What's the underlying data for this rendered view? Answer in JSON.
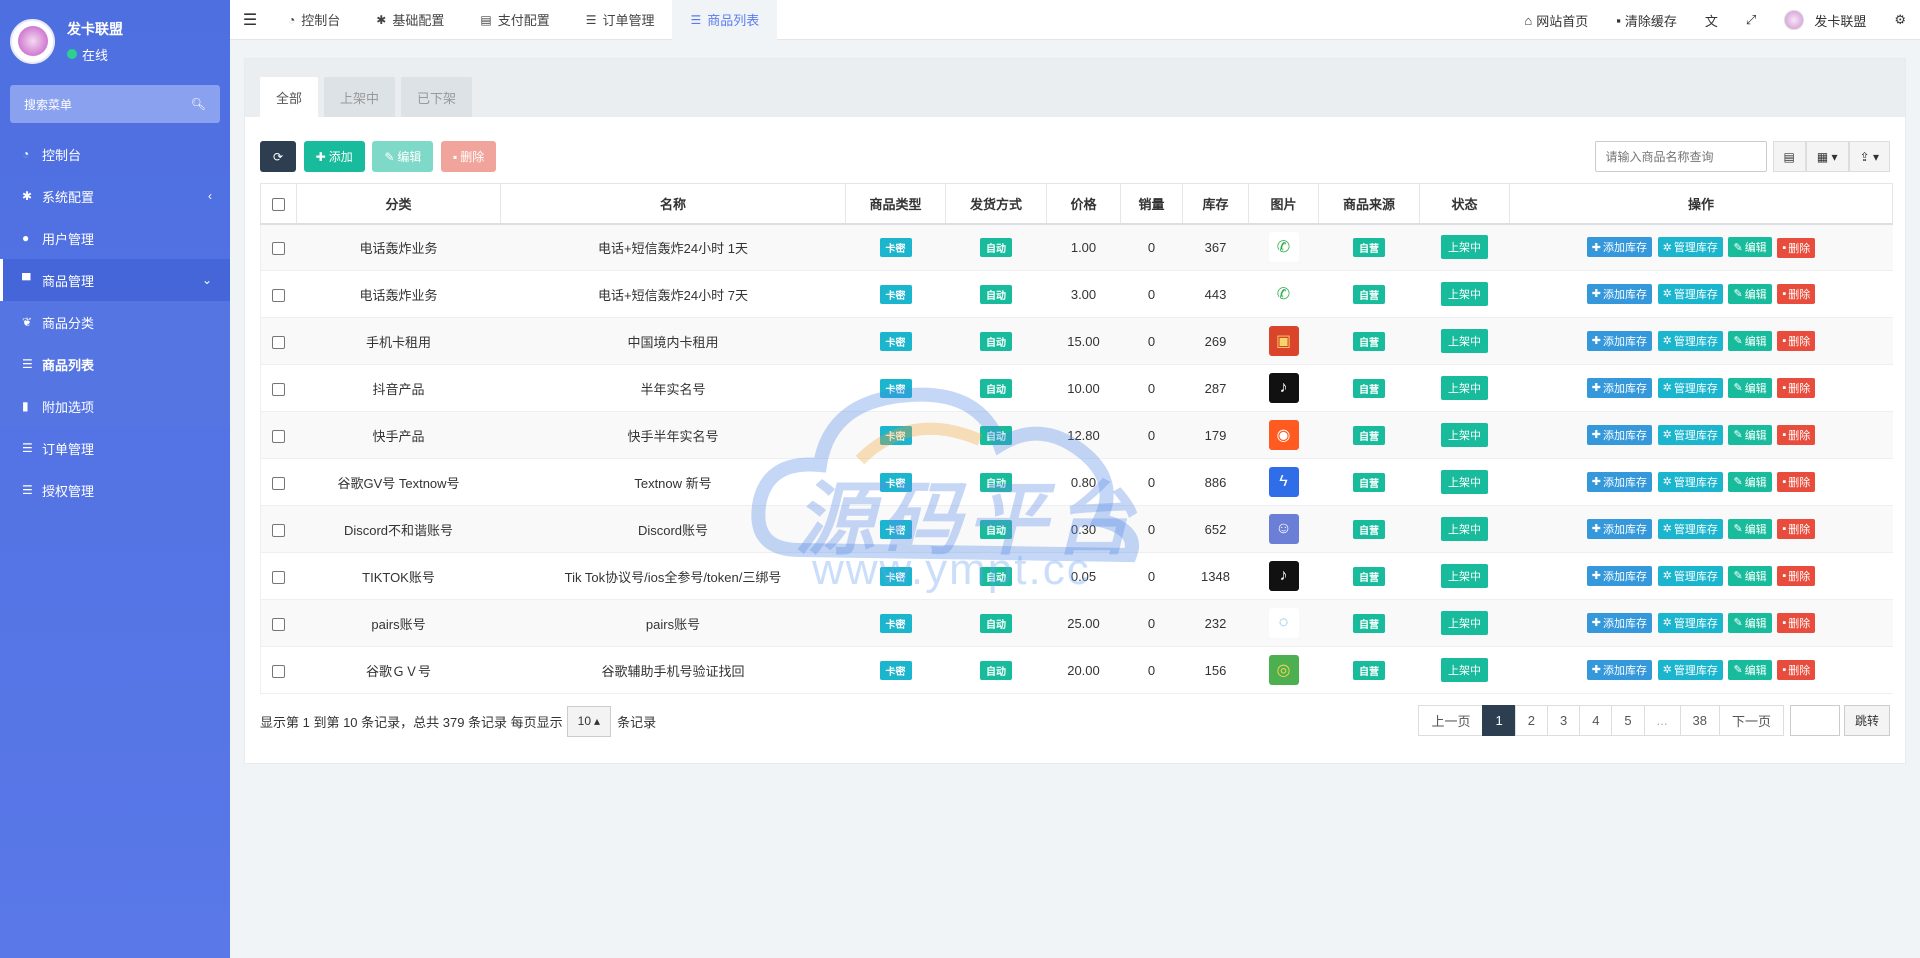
{
  "sidebar": {
    "user_name": "发卡联盟",
    "status": "在线",
    "search_placeholder": "搜索菜单",
    "items": [
      {
        "label": "控制台",
        "icon": "dashboard-icon"
      },
      {
        "label": "系统配置",
        "icon": "gear-icon"
      },
      {
        "label": "用户管理",
        "icon": "user-icon"
      },
      {
        "label": "商品管理",
        "icon": "cart-icon"
      },
      {
        "label": "商品分类",
        "icon": "leaf-icon"
      },
      {
        "label": "商品列表",
        "icon": "list-icon"
      },
      {
        "label": "附加选项",
        "icon": "bookmark-icon"
      },
      {
        "label": "订单管理",
        "icon": "list-icon"
      },
      {
        "label": "授权管理",
        "icon": "list-icon"
      }
    ]
  },
  "topbar": {
    "tabs": [
      {
        "label": "控制台"
      },
      {
        "label": "基础配置"
      },
      {
        "label": "支付配置"
      },
      {
        "label": "订单管理"
      },
      {
        "label": "商品列表"
      }
    ],
    "home_label": "网站首页",
    "clear_cache_label": "清除缓存",
    "user_label": "发卡联盟"
  },
  "filter_tabs": [
    "全部",
    "上架中",
    "已下架"
  ],
  "toolbar": {
    "add_label": "添加",
    "edit_label": "编辑",
    "delete_label": "删除",
    "search_placeholder": "请输入商品名称查询"
  },
  "table": {
    "headers": [
      "分类",
      "名称",
      "商品类型",
      "发货方式",
      "价格",
      "销量",
      "库存",
      "图片",
      "商品来源",
      "状态",
      "操作"
    ],
    "type_label": "卡密",
    "ship_label": "自动",
    "source_label": "自营",
    "state_label": "上架中",
    "actions": {
      "add_stock": "添加库存",
      "manage_stock": "管理库存",
      "edit": "编辑",
      "delete": "删除"
    },
    "rows": [
      {
        "category": "电话轰炸业务",
        "name": "电话+短信轰炸24小时 1天",
        "price": "1.00",
        "sales": "0",
        "stock": "367",
        "pic": "phone-icon"
      },
      {
        "category": "电话轰炸业务",
        "name": "电话+短信轰炸24小时 7天",
        "price": "3.00",
        "sales": "0",
        "stock": "443",
        "pic": "phone-icon"
      },
      {
        "category": "手机卡租用",
        "name": "中国境内卡租用",
        "price": "15.00",
        "sales": "0",
        "stock": "269",
        "pic": "sim-card-icon"
      },
      {
        "category": "抖音产品",
        "name": "半年实名号",
        "price": "10.00",
        "sales": "0",
        "stock": "287",
        "pic": "tiktok-icon"
      },
      {
        "category": "快手产品",
        "name": "快手半年实名号",
        "price": "12.80",
        "sales": "0",
        "stock": "179",
        "pic": "kuaishou-icon"
      },
      {
        "category": "谷歌GV号 Textnow号",
        "name": "Textnow 新号",
        "price": "0.80",
        "sales": "0",
        "stock": "886",
        "pic": "textnow-icon"
      },
      {
        "category": "Discord不和谐账号",
        "name": "Discord账号",
        "price": "0.30",
        "sales": "0",
        "stock": "652",
        "pic": "discord-icon"
      },
      {
        "category": "TIKTOK账号",
        "name": "Tik Tok协议号/ios全参号/token/三绑号",
        "price": "0.05",
        "sales": "0",
        "stock": "1348",
        "pic": "tiktok-icon"
      },
      {
        "category": "pairs账号",
        "name": "pairs账号",
        "price": "25.00",
        "sales": "0",
        "stock": "232",
        "pic": "pairs-icon"
      },
      {
        "category": "谷歌ＧＶ号",
        "name": "谷歌辅助手机号验证找回",
        "price": "20.00",
        "sales": "0",
        "stock": "156",
        "pic": "chrome-icon"
      }
    ]
  },
  "footer": {
    "summary_prefix": "显示第 1 到第 10 条记录，总共 379 条记录 每页显示",
    "page_size": "10",
    "summary_suffix": "条记录",
    "prev": "上一页",
    "pages": [
      "1",
      "2",
      "3",
      "4",
      "5",
      "...",
      "38"
    ],
    "next": "下一页",
    "jump": "跳转"
  },
  "watermark": {
    "text": "源码平台",
    "url": "www.ympt.cc"
  },
  "colors": {
    "sidebar": "#5a78e8",
    "accent": "#18bc9c",
    "info": "#1bb5ce",
    "danger": "#e74c3c",
    "primary": "#3498db",
    "dark": "#2c3e50"
  }
}
